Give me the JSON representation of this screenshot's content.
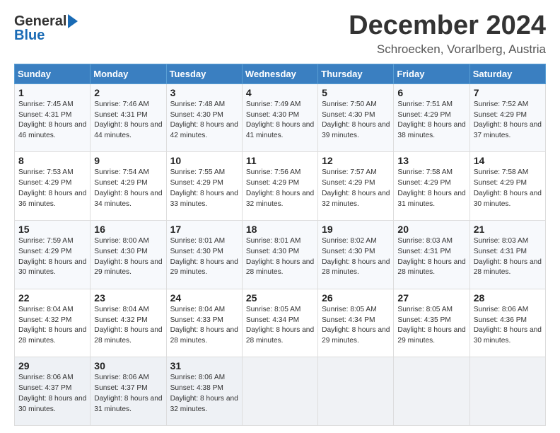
{
  "logo": {
    "general": "General",
    "blue": "Blue"
  },
  "title": "December 2024",
  "location": "Schroecken, Vorarlberg, Austria",
  "days_of_week": [
    "Sunday",
    "Monday",
    "Tuesday",
    "Wednesday",
    "Thursday",
    "Friday",
    "Saturday"
  ],
  "weeks": [
    [
      {
        "day": 1,
        "sunrise": "7:45 AM",
        "sunset": "4:31 PM",
        "daylight": "8 hours and 46 minutes."
      },
      {
        "day": 2,
        "sunrise": "7:46 AM",
        "sunset": "4:31 PM",
        "daylight": "8 hours and 44 minutes."
      },
      {
        "day": 3,
        "sunrise": "7:48 AM",
        "sunset": "4:30 PM",
        "daylight": "8 hours and 42 minutes."
      },
      {
        "day": 4,
        "sunrise": "7:49 AM",
        "sunset": "4:30 PM",
        "daylight": "8 hours and 41 minutes."
      },
      {
        "day": 5,
        "sunrise": "7:50 AM",
        "sunset": "4:30 PM",
        "daylight": "8 hours and 39 minutes."
      },
      {
        "day": 6,
        "sunrise": "7:51 AM",
        "sunset": "4:29 PM",
        "daylight": "8 hours and 38 minutes."
      },
      {
        "day": 7,
        "sunrise": "7:52 AM",
        "sunset": "4:29 PM",
        "daylight": "8 hours and 37 minutes."
      }
    ],
    [
      {
        "day": 8,
        "sunrise": "7:53 AM",
        "sunset": "4:29 PM",
        "daylight": "8 hours and 36 minutes."
      },
      {
        "day": 9,
        "sunrise": "7:54 AM",
        "sunset": "4:29 PM",
        "daylight": "8 hours and 34 minutes."
      },
      {
        "day": 10,
        "sunrise": "7:55 AM",
        "sunset": "4:29 PM",
        "daylight": "8 hours and 33 minutes."
      },
      {
        "day": 11,
        "sunrise": "7:56 AM",
        "sunset": "4:29 PM",
        "daylight": "8 hours and 32 minutes."
      },
      {
        "day": 12,
        "sunrise": "7:57 AM",
        "sunset": "4:29 PM",
        "daylight": "8 hours and 32 minutes."
      },
      {
        "day": 13,
        "sunrise": "7:58 AM",
        "sunset": "4:29 PM",
        "daylight": "8 hours and 31 minutes."
      },
      {
        "day": 14,
        "sunrise": "7:58 AM",
        "sunset": "4:29 PM",
        "daylight": "8 hours and 30 minutes."
      }
    ],
    [
      {
        "day": 15,
        "sunrise": "7:59 AM",
        "sunset": "4:29 PM",
        "daylight": "8 hours and 30 minutes."
      },
      {
        "day": 16,
        "sunrise": "8:00 AM",
        "sunset": "4:30 PM",
        "daylight": "8 hours and 29 minutes."
      },
      {
        "day": 17,
        "sunrise": "8:01 AM",
        "sunset": "4:30 PM",
        "daylight": "8 hours and 29 minutes."
      },
      {
        "day": 18,
        "sunrise": "8:01 AM",
        "sunset": "4:30 PM",
        "daylight": "8 hours and 28 minutes."
      },
      {
        "day": 19,
        "sunrise": "8:02 AM",
        "sunset": "4:30 PM",
        "daylight": "8 hours and 28 minutes."
      },
      {
        "day": 20,
        "sunrise": "8:03 AM",
        "sunset": "4:31 PM",
        "daylight": "8 hours and 28 minutes."
      },
      {
        "day": 21,
        "sunrise": "8:03 AM",
        "sunset": "4:31 PM",
        "daylight": "8 hours and 28 minutes."
      }
    ],
    [
      {
        "day": 22,
        "sunrise": "8:04 AM",
        "sunset": "4:32 PM",
        "daylight": "8 hours and 28 minutes."
      },
      {
        "day": 23,
        "sunrise": "8:04 AM",
        "sunset": "4:32 PM",
        "daylight": "8 hours and 28 minutes."
      },
      {
        "day": 24,
        "sunrise": "8:04 AM",
        "sunset": "4:33 PM",
        "daylight": "8 hours and 28 minutes."
      },
      {
        "day": 25,
        "sunrise": "8:05 AM",
        "sunset": "4:34 PM",
        "daylight": "8 hours and 28 minutes."
      },
      {
        "day": 26,
        "sunrise": "8:05 AM",
        "sunset": "4:34 PM",
        "daylight": "8 hours and 29 minutes."
      },
      {
        "day": 27,
        "sunrise": "8:05 AM",
        "sunset": "4:35 PM",
        "daylight": "8 hours and 29 minutes."
      },
      {
        "day": 28,
        "sunrise": "8:06 AM",
        "sunset": "4:36 PM",
        "daylight": "8 hours and 30 minutes."
      }
    ],
    [
      {
        "day": 29,
        "sunrise": "8:06 AM",
        "sunset": "4:37 PM",
        "daylight": "8 hours and 30 minutes."
      },
      {
        "day": 30,
        "sunrise": "8:06 AM",
        "sunset": "4:37 PM",
        "daylight": "8 hours and 31 minutes."
      },
      {
        "day": 31,
        "sunrise": "8:06 AM",
        "sunset": "4:38 PM",
        "daylight": "8 hours and 32 minutes."
      },
      null,
      null,
      null,
      null
    ]
  ]
}
